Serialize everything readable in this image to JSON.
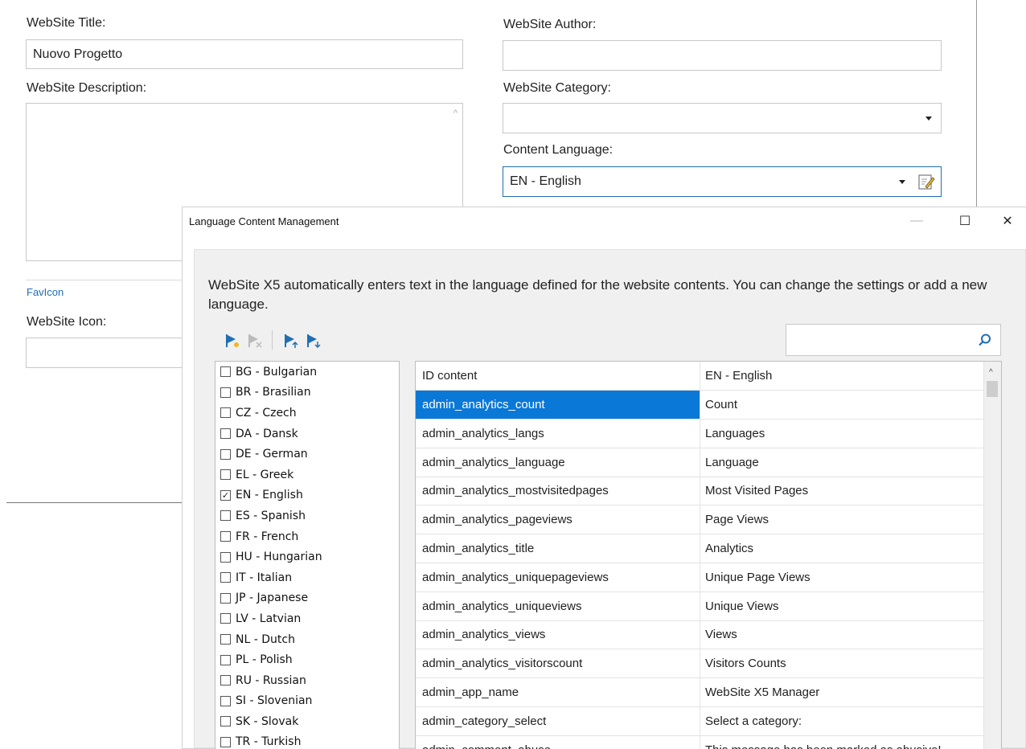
{
  "form": {
    "title_label": "WebSite Title:",
    "title_value": "Nuovo Progetto",
    "author_label": "WebSite Author:",
    "author_value": "",
    "description_label": "WebSite Description:",
    "category_label": "WebSite Category:",
    "category_value": "",
    "content_language_label": "Content Language:",
    "content_language_value": "EN - English",
    "favicon_section": "FavIcon",
    "icon_label": "WebSite Icon:"
  },
  "dialog": {
    "title": "Language Content Management",
    "minimize_glyph": "—",
    "maximize_glyph": "☐",
    "close_glyph": "✕",
    "intro": "WebSite X5 automatically enters text in the language defined for the website contents. You can change the settings or add a new language.",
    "search_placeholder": "",
    "toolbar_icons": [
      "add-language-icon",
      "remove-language-icon",
      "import-language-icon",
      "export-language-icon"
    ],
    "languages": [
      {
        "label": "BG - Bulgarian",
        "checked": false
      },
      {
        "label": "BR - Brasilian",
        "checked": false
      },
      {
        "label": "CZ - Czech",
        "checked": false
      },
      {
        "label": "DA - Dansk",
        "checked": false
      },
      {
        "label": "DE - German",
        "checked": false
      },
      {
        "label": "EL - Greek",
        "checked": false
      },
      {
        "label": "EN - English",
        "checked": true
      },
      {
        "label": "ES - Spanish",
        "checked": false
      },
      {
        "label": "FR - French",
        "checked": false
      },
      {
        "label": "HU - Hungarian",
        "checked": false
      },
      {
        "label": "IT - Italian",
        "checked": false
      },
      {
        "label": "JP - Japanese",
        "checked": false
      },
      {
        "label": "LV - Latvian",
        "checked": false
      },
      {
        "label": "NL - Dutch",
        "checked": false
      },
      {
        "label": "PL - Polish",
        "checked": false
      },
      {
        "label": "RU - Russian",
        "checked": false
      },
      {
        "label": "SI - Slovenian",
        "checked": false
      },
      {
        "label": "SK - Slovak",
        "checked": false
      },
      {
        "label": "TR - Turkish",
        "checked": false
      }
    ],
    "table": {
      "headers": [
        "ID content",
        "EN - English"
      ],
      "rows": [
        {
          "id": "admin_analytics_count",
          "value": "Count",
          "selected": true
        },
        {
          "id": "admin_analytics_langs",
          "value": "Languages"
        },
        {
          "id": "admin_analytics_language",
          "value": "Language"
        },
        {
          "id": "admin_analytics_mostvisitedpages",
          "value": "Most Visited Pages"
        },
        {
          "id": "admin_analytics_pageviews",
          "value": "Page Views"
        },
        {
          "id": "admin_analytics_title",
          "value": "Analytics"
        },
        {
          "id": "admin_analytics_uniquepageviews",
          "value": "Unique Page Views"
        },
        {
          "id": "admin_analytics_uniqueviews",
          "value": "Unique Views"
        },
        {
          "id": "admin_analytics_views",
          "value": "Views"
        },
        {
          "id": "admin_analytics_visitorscount",
          "value": "Visitors Counts"
        },
        {
          "id": "admin_app_name",
          "value": "WebSite X5 Manager"
        },
        {
          "id": "admin_category_select",
          "value": "Select a category:"
        },
        {
          "id": "admin_comment_abuse",
          "value": "This message has been marked as abusive!"
        }
      ]
    }
  },
  "colors": {
    "selection": "#0a78d7",
    "focus_border": "#1f6fb3",
    "flag_icon": "#1f6fb3"
  }
}
